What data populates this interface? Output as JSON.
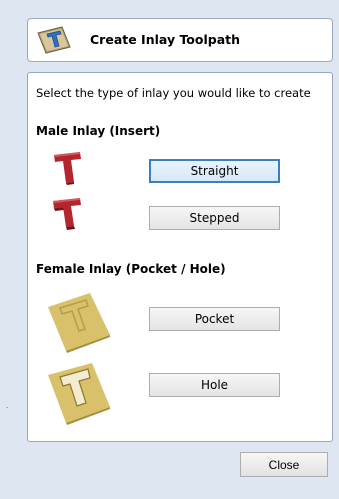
{
  "header": {
    "title": "Create Inlay Toolpath",
    "icon": "inlay-toolpath-icon"
  },
  "intro_text": "Select the type of inlay you would like to create",
  "male_section": {
    "title": "Male Inlay (Insert)",
    "straight_label": "Straight",
    "stepped_label": "Stepped"
  },
  "female_section": {
    "title": "Female Inlay (Pocket / Hole)",
    "pocket_label": "Pocket",
    "hole_label": "Hole"
  },
  "footer": {
    "close_label": "Close"
  },
  "colors": {
    "background": "#dde6f1",
    "focus_border": "#3c7fc1",
    "male_icon": "#b3262e",
    "female_icon": "#d9c06a"
  }
}
